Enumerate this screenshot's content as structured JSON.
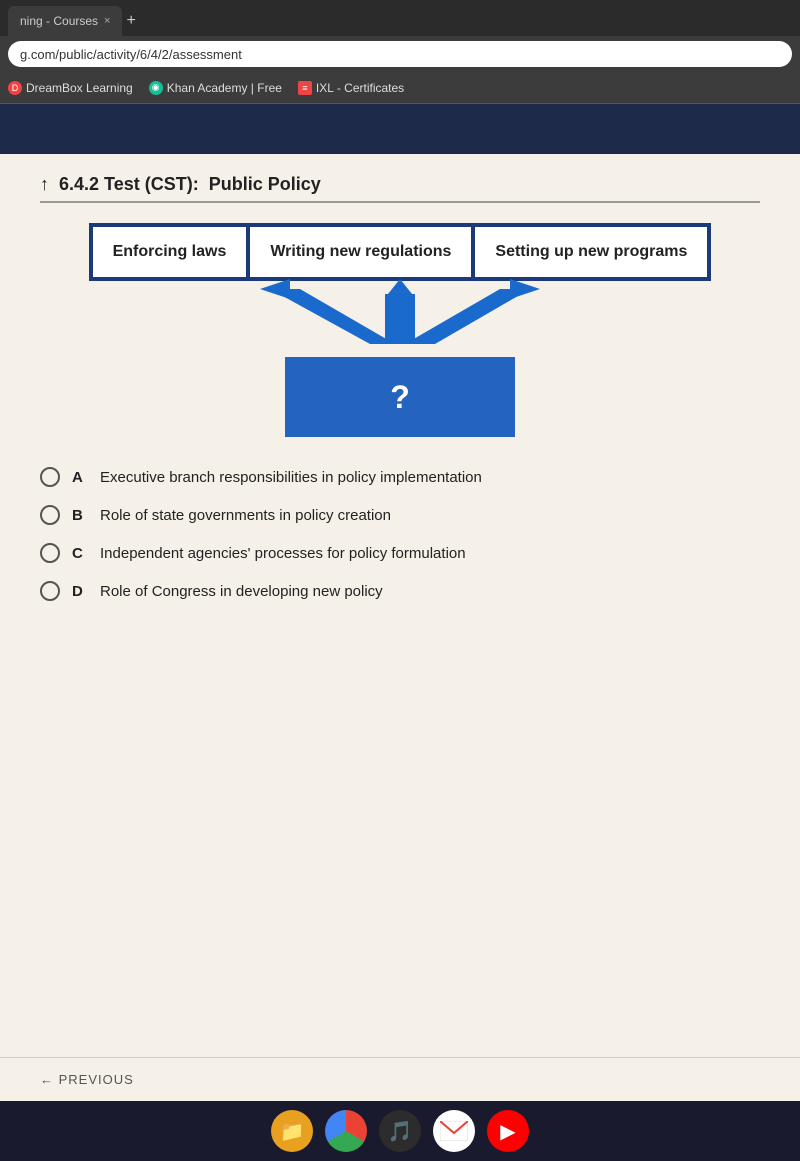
{
  "browser": {
    "tab_label": "ning - Courses",
    "close_btn": "×",
    "plus_btn": "+",
    "address": "g.com/public/activity/6/4/2/assessment",
    "bookmarks": [
      {
        "id": "dreambox",
        "label": "DreamBox Learning",
        "icon": "D",
        "icon_color": "#e44"
      },
      {
        "id": "khan",
        "label": "Khan Academy | Free",
        "icon": "◉",
        "icon_color": "#14bf96"
      },
      {
        "id": "ixl",
        "label": "IXL - Certificates",
        "icon": "≡",
        "icon_color": "#e44"
      }
    ]
  },
  "app": {
    "nav_color": "#1e2a4a",
    "test_label": "6.4.2 Test (CST):",
    "test_subtitle": "Public Policy"
  },
  "diagram": {
    "boxes": [
      {
        "id": "enforcing-laws",
        "text": "Enforcing laws"
      },
      {
        "id": "writing-regulations",
        "text": "Writing new regulations"
      },
      {
        "id": "setting-programs",
        "text": "Setting up new programs"
      }
    ],
    "question_mark": "?",
    "arrow_color": "#1a6acd"
  },
  "answers": [
    {
      "id": "A",
      "text": "Executive branch responsibilities in policy implementation"
    },
    {
      "id": "B",
      "text": "Role of state governments in policy creation"
    },
    {
      "id": "C",
      "text": "Independent agencies' processes for policy formulation"
    },
    {
      "id": "D",
      "text": "Role of Congress in developing new policy"
    }
  ],
  "navigation": {
    "previous_label": "← PREVIOUS"
  }
}
